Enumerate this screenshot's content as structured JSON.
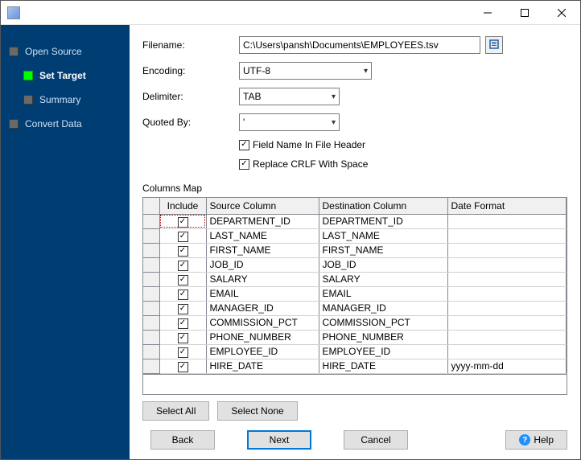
{
  "sidebar": {
    "items": [
      {
        "label": "Open Source",
        "active": false,
        "sub": false
      },
      {
        "label": "Set Target",
        "active": true,
        "sub": true
      },
      {
        "label": "Summary",
        "active": false,
        "sub": true
      },
      {
        "label": "Convert Data",
        "active": false,
        "sub": false
      }
    ]
  },
  "form": {
    "filename_label": "Filename:",
    "filename_value": "C:\\Users\\pansh\\Documents\\EMPLOYEES.tsv",
    "encoding_label": "Encoding:",
    "encoding_value": "UTF-8",
    "delimiter_label": "Delimiter:",
    "delimiter_value": "TAB",
    "quoted_label": "Quoted By:",
    "quoted_value": "'",
    "chk_header_label": "Field Name In File Header",
    "chk_header_checked": true,
    "chk_crlf_label": "Replace CRLF With Space",
    "chk_crlf_checked": true
  },
  "columns_map": {
    "title": "Columns Map",
    "headers": {
      "include": "Include",
      "source": "Source Column",
      "dest": "Destination Column",
      "fmt": "Date Format"
    },
    "rows": [
      {
        "include": true,
        "source": "DEPARTMENT_ID",
        "dest": "DEPARTMENT_ID",
        "fmt": ""
      },
      {
        "include": true,
        "source": "LAST_NAME",
        "dest": "LAST_NAME",
        "fmt": ""
      },
      {
        "include": true,
        "source": "FIRST_NAME",
        "dest": "FIRST_NAME",
        "fmt": ""
      },
      {
        "include": true,
        "source": "JOB_ID",
        "dest": "JOB_ID",
        "fmt": ""
      },
      {
        "include": true,
        "source": "SALARY",
        "dest": "SALARY",
        "fmt": ""
      },
      {
        "include": true,
        "source": "EMAIL",
        "dest": "EMAIL",
        "fmt": ""
      },
      {
        "include": true,
        "source": "MANAGER_ID",
        "dest": "MANAGER_ID",
        "fmt": ""
      },
      {
        "include": true,
        "source": "COMMISSION_PCT",
        "dest": "COMMISSION_PCT",
        "fmt": ""
      },
      {
        "include": true,
        "source": "PHONE_NUMBER",
        "dest": "PHONE_NUMBER",
        "fmt": ""
      },
      {
        "include": true,
        "source": "EMPLOYEE_ID",
        "dest": "EMPLOYEE_ID",
        "fmt": ""
      },
      {
        "include": true,
        "source": "HIRE_DATE",
        "dest": "HIRE_DATE",
        "fmt": "yyyy-mm-dd"
      }
    ]
  },
  "buttons": {
    "select_all": "Select All",
    "select_none": "Select None",
    "back": "Back",
    "next": "Next",
    "cancel": "Cancel",
    "help": "Help"
  }
}
